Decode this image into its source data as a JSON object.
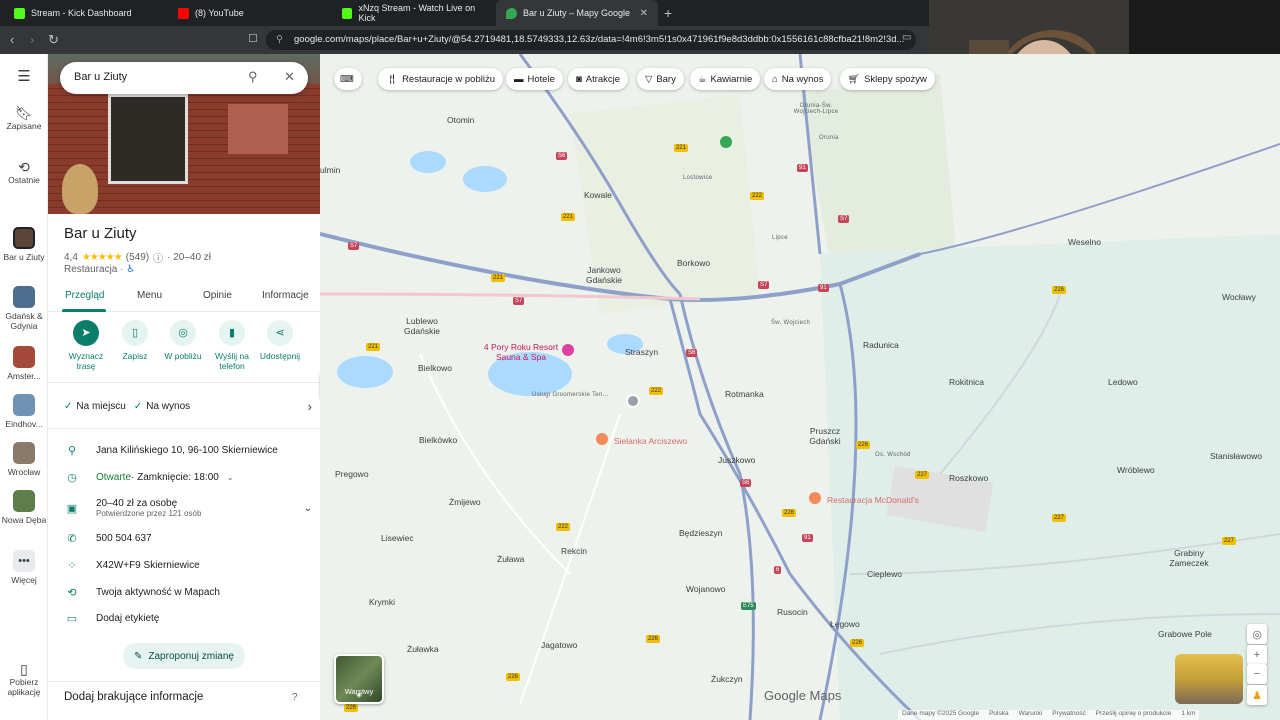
{
  "browser": {
    "tabs": [
      {
        "label": "Stream - Kick Dashboard",
        "favicon": "kick-icon",
        "color": "#53fc18"
      },
      {
        "label": "(8) YouTube",
        "favicon": "youtube-icon",
        "color": "#ff0000"
      },
      {
        "label": "xNzq Stream - Watch Live on Kick",
        "favicon": "kick-icon",
        "color": "#53fc18"
      },
      {
        "label": "Bar u Ziuty – Mapy Google",
        "favicon": "google-maps-icon",
        "color": "#34a853"
      }
    ],
    "url": "google.com/maps/place/Bar+u+Ziuty/@54.2719481,18.5749333,12.63z/data=!4m6!3m5!1s0x471961f9e8d3ddbb:0x1556161c88cfba21!8m2!3d..."
  },
  "rail": {
    "items": [
      {
        "label": "Zapisane",
        "icon": "bookmark-icon"
      },
      {
        "label": "Ostatnie",
        "icon": "history-icon"
      },
      {
        "label": "Bar u Ziuty",
        "icon": "place-thumb"
      },
      {
        "label": "Gdańsk & Gdynia",
        "icon": "place-thumb"
      },
      {
        "label": "Amster...",
        "icon": "place-thumb"
      },
      {
        "label": "Eindhov...",
        "icon": "place-thumb"
      },
      {
        "label": "Wrocław",
        "icon": "place-thumb"
      },
      {
        "label": "Nowa Dęba",
        "icon": "place-thumb"
      },
      {
        "label": "Więcej",
        "icon": "more-icon"
      }
    ],
    "download_label": "Pobierz aplikację"
  },
  "search": {
    "value": "Bar u Ziuty"
  },
  "place": {
    "title": "Bar u Ziuty",
    "rating": "4,4",
    "stars": "★★★★★",
    "reviews": "(549)",
    "price": "· 20–40 zł",
    "category": "Restauracja ·",
    "tabs": [
      "Przegląd",
      "Menu",
      "Opinie",
      "Informacje"
    ],
    "actions": [
      "Wyznacz trasę",
      "Zapisz",
      "W pobliżu",
      "Wyślij na telefon",
      "Udostępnij"
    ],
    "service_options": [
      "Na miejscu",
      "Na wynos"
    ],
    "address": "Jana Kilińskiego 10, 96-100 Skierniewice",
    "hours_status": "Otwarte",
    "hours_close": " · Zamknięcie: 18:00",
    "price_range": "20–40 zł za osobę",
    "price_confirmed": "Potwierdzone przez 121 osób",
    "phone": "500 504 637",
    "plus_code": "X42W+F9 Skierniewice",
    "activity": "Twoja aktywność w Mapach",
    "add_label": "Dodaj etykietę",
    "suggest_edit": "Zaproponuj zmianę",
    "add_missing": "Dodaj brakujące informacje"
  },
  "map": {
    "chips": [
      "Restauracje w pobliżu",
      "Hotele",
      "Atrakcje",
      "Bary",
      "Kawiarnie",
      "Na wynos",
      "Sklepy spożyw"
    ],
    "labels": [
      "Otomin",
      "Kowale",
      "Borkowo",
      "Jankowo Gdańskie",
      "Lublewo Gdańskie",
      "Bielkowo",
      "Straszyn",
      "Rotmanka",
      "Radunica",
      "Rokitnica",
      "Ledowo",
      "Wocławy",
      "Weselno",
      "Bielkówko",
      "Pregowo",
      "Żmijewo",
      "Lisewiec",
      "Żuława",
      "Rekcin",
      "Juszkowo",
      "Pruszcz Gdański",
      "Roszkowo",
      "Wróblewo",
      "Stanisławowo",
      "Będzieszyn",
      "Wojanowo",
      "Cieplewo",
      "Grabiny Zameczek",
      "Krymki",
      "Jagatowo",
      "Rusocin",
      "Łęgowo",
      "Grabowe Pole",
      "Żuławka",
      "Żukczyn",
      "Lostowice",
      "Orunia",
      "Orunia-Św. Wojciech-Lipce",
      "Lipce",
      "Św. Wojciech",
      "Usługi Groomerskie Ten...",
      "Os. Wschód",
      "ulmin"
    ],
    "pois": [
      "4 Pory Roku Resort Sauna & Spa",
      "Sielanka Arciszewo",
      "Restauracja McDonald's"
    ],
    "layers_label": "Warstwy",
    "logo": "Google Maps",
    "attribution": [
      "Dane mapy ©2025 Google",
      "Polska",
      "Warunki",
      "Prywatność",
      "Prześlij opinię o produkcie",
      "1 km"
    ]
  }
}
